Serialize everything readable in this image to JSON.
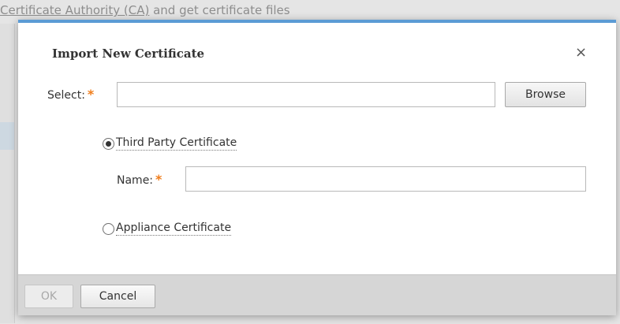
{
  "background": {
    "link_text": "Certificate Authority (CA)",
    "text_after_link": " and get certificate files"
  },
  "dialog": {
    "title": "Import New Certificate",
    "close_icon": "×",
    "select": {
      "label": "Select:",
      "required_marker": "*",
      "value": "",
      "browse_label": "Browse"
    },
    "third_party": {
      "label": "Third Party Certificate",
      "checked": true
    },
    "name": {
      "label": "Name:",
      "required_marker": "*",
      "value": ""
    },
    "appliance": {
      "label": "Appliance Certificate",
      "checked": false
    },
    "footer": {
      "ok_label": "OK",
      "ok_disabled": true,
      "cancel_label": "Cancel"
    }
  },
  "colors": {
    "accent": "#5b9bd5",
    "required": "#f07d1b",
    "footer_bg": "#d6d6d6"
  }
}
